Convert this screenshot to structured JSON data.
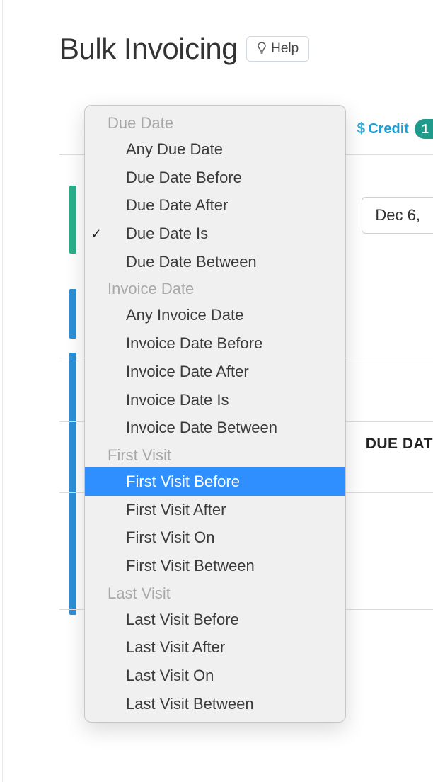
{
  "header": {
    "title": "Bulk Invoicing",
    "help_label": "Help"
  },
  "background": {
    "credit_label": "Credit",
    "credit_badge": "1",
    "date_value": "Dec 6,",
    "column_header": "DUE DAT"
  },
  "dropdown": {
    "groups": [
      {
        "label": "Due Date",
        "items": [
          {
            "label": "Any Due Date",
            "checked": false,
            "selected": false
          },
          {
            "label": "Due Date Before",
            "checked": false,
            "selected": false
          },
          {
            "label": "Due Date After",
            "checked": false,
            "selected": false
          },
          {
            "label": "Due Date Is",
            "checked": true,
            "selected": false
          },
          {
            "label": "Due Date Between",
            "checked": false,
            "selected": false
          }
        ]
      },
      {
        "label": "Invoice Date",
        "items": [
          {
            "label": "Any Invoice Date",
            "checked": false,
            "selected": false
          },
          {
            "label": "Invoice Date Before",
            "checked": false,
            "selected": false
          },
          {
            "label": "Invoice Date After",
            "checked": false,
            "selected": false
          },
          {
            "label": "Invoice Date Is",
            "checked": false,
            "selected": false
          },
          {
            "label": "Invoice Date Between",
            "checked": false,
            "selected": false
          }
        ]
      },
      {
        "label": "First Visit",
        "items": [
          {
            "label": "First Visit Before",
            "checked": false,
            "selected": true
          },
          {
            "label": "First Visit After",
            "checked": false,
            "selected": false
          },
          {
            "label": "First Visit On",
            "checked": false,
            "selected": false
          },
          {
            "label": "First Visit Between",
            "checked": false,
            "selected": false
          }
        ]
      },
      {
        "label": "Last Visit",
        "items": [
          {
            "label": "Last Visit Before",
            "checked": false,
            "selected": false
          },
          {
            "label": "Last Visit After",
            "checked": false,
            "selected": false
          },
          {
            "label": "Last Visit On",
            "checked": false,
            "selected": false
          },
          {
            "label": "Last Visit Between",
            "checked": false,
            "selected": false
          }
        ]
      }
    ]
  }
}
